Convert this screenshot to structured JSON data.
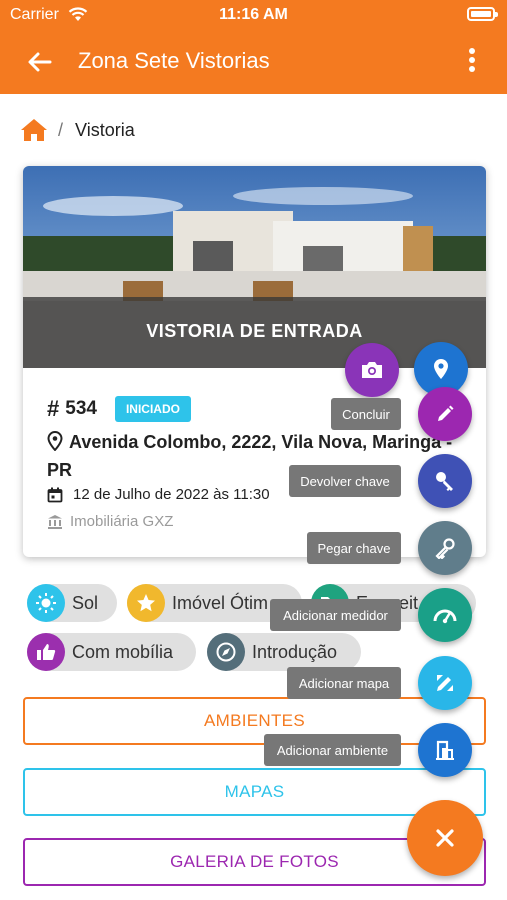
{
  "status_bar": {
    "carrier": "Carrier",
    "time": "11:16 AM"
  },
  "app_bar": {
    "title": "Zona Sete Vistorias",
    "back_icon": "arrow-left-icon",
    "menu_icon": "more-vertical-icon"
  },
  "breadcrumb": {
    "home_icon": "home-icon",
    "separator": "/",
    "current": "Vistoria"
  },
  "card": {
    "hero_label": "VISTORIA DE ENTRADA",
    "hash": "#",
    "id": "534",
    "status": "INICIADO",
    "address": "Avenida Colombo, 2222, Vila Nova, Maringa - PR",
    "date": "12 de Julho de 2022 às 11:30",
    "agency": "Imobiliária GXZ"
  },
  "chips": [
    {
      "label": "Sol",
      "icon": "sun-icon",
      "color": "#2ec3ea"
    },
    {
      "label": "Imóvel Ótim",
      "icon": "star-icon",
      "color": "#f1b82d"
    },
    {
      "label": "Empreit",
      "icon": "folder-icon",
      "color": "#1fa37f"
    },
    {
      "label": "Com mobília",
      "icon": "thumbs-up-icon",
      "color": "#9b2fae"
    },
    {
      "label": "Introdução",
      "icon": "compass-icon",
      "color": "#546e7a"
    }
  ],
  "buttons": {
    "ambientes": "AMBIENTES",
    "mapas": "MAPAS",
    "galeria": "GALERIA DE FOTOS"
  },
  "fab_menu": {
    "camera_icon": "camera-icon",
    "location_icon": "location-pin-icon",
    "items": [
      {
        "label": "Concluir",
        "icon": "pencil-icon",
        "color": "#9c27b0"
      },
      {
        "label": "Devolver chave",
        "icon": "key-icon",
        "color": "#3f51b5"
      },
      {
        "label": "Pegar chave",
        "icon": "key-outline-icon",
        "color": "#607d8b"
      },
      {
        "label": "Adicionar medidor",
        "icon": "gauge-icon",
        "color": "#1aa088"
      },
      {
        "label": "Adicionar mapa",
        "icon": "ruler-pencil-icon",
        "color": "#29b6e8"
      },
      {
        "label": "Adicionar ambiente",
        "icon": "door-icon",
        "color": "#1e74d1"
      }
    ],
    "close_icon": "close-icon"
  },
  "colors": {
    "brand": "#f47a20",
    "ambientes": "#f47a20",
    "mapas": "#2ec3ea",
    "galeria": "#9c27b0",
    "status_badge": "#2ec3ea"
  }
}
